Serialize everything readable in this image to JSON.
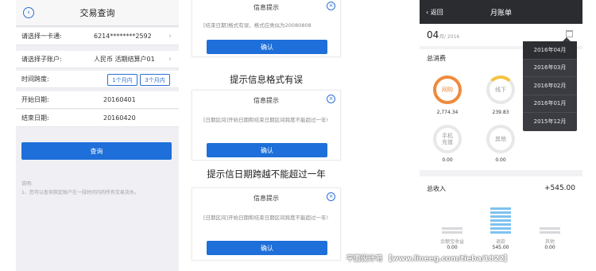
{
  "query_screen": {
    "title": "交易查询",
    "card_label": "请选择一卡通:",
    "card_value": "6214********2592",
    "account_label": "请选择子账户:",
    "account_value": "人民币 活期结算户01",
    "span_label": "时间跨度:",
    "span_options": [
      "1个月内",
      "3个月内"
    ],
    "start_label": "开始日期:",
    "start_value": "20160401",
    "end_label": "结束日期:",
    "end_value": "20160420",
    "submit_label": "查询",
    "note_title": "说明:",
    "note_text": "1、您可以查询指定账户在一段时间内的所有交易流水。"
  },
  "dialogs": [
    {
      "title": "信息提示",
      "message": "[结束日期]格式有误，格式应类似为20080808",
      "ok_label": "确认"
    },
    {
      "title": "信息提示",
      "message": "[日期区间]开始日期和结束日期区间跨度不能超过一年!",
      "ok_label": "确认"
    },
    {
      "title": "信息提示",
      "message": "[日期区间]开始日期和结束日期区间跨度不能超过一年!",
      "ok_label": "确认"
    }
  ],
  "captions": {
    "format_error": "提示信息格式有误",
    "range_error": "提示信日期跨越不能超过一年"
  },
  "bill_screen": {
    "back_label": "返回",
    "title": "月账单",
    "month": "04",
    "year": "月/ 2016",
    "total_spend_label": "总消费",
    "spend_items": [
      {
        "label": "网购",
        "amount": "2,774.34",
        "color": "#f08a3c"
      },
      {
        "label": "线下",
        "amount": "239.83",
        "color": "#f5c341"
      },
      {
        "label": "手机\n充值",
        "amount": "0.00",
        "color": "#dddde0"
      },
      {
        "label": "其他",
        "amount": "0.00",
        "color": "#dddde0"
      }
    ],
    "total_income_label": "总收入",
    "total_income_value": "+545.00",
    "income_items": [
      {
        "label": "余额宝收益",
        "amount": "0.00"
      },
      {
        "label": "退款",
        "amount": "545.00"
      },
      {
        "label": "其他",
        "amount": "0.00"
      }
    ],
    "month_options": [
      "2016年04月",
      "2016年03月",
      "2016年02月",
      "2016年01月",
      "2015年12月"
    ]
  },
  "watermark": "平面设计吧 【www.lineeg.com/tieba/1822】"
}
